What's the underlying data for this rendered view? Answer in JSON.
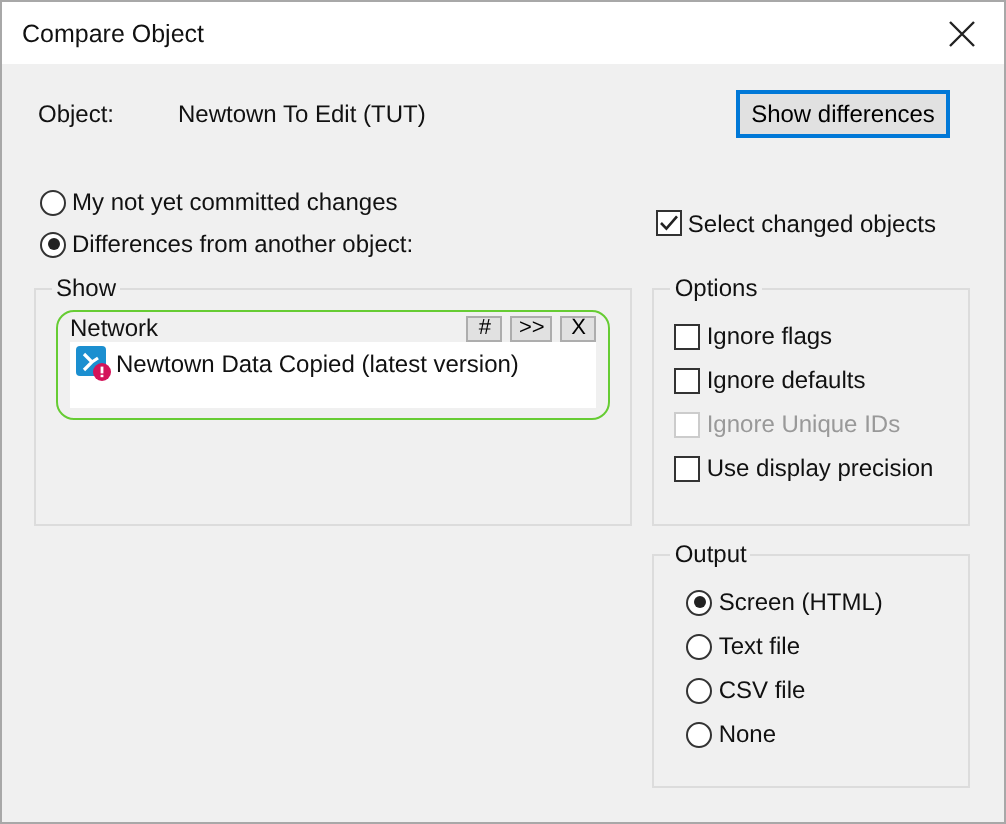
{
  "window": {
    "title": "Compare Object"
  },
  "object": {
    "label": "Object:",
    "value": "Newtown To Edit (TUT)"
  },
  "show_differences_button": "Show differences",
  "compare_with": [
    {
      "label": "My not yet committed changes",
      "selected": false
    },
    {
      "label": "Differences from another object:",
      "selected": true
    }
  ],
  "select_changed_objects": {
    "label": "Select changed objects",
    "checked": true
  },
  "show": {
    "title": "Show",
    "network": {
      "title": "Network",
      "buttons": [
        "#",
        ">>",
        "X"
      ],
      "items": [
        {
          "label": "Newtown Data Copied (latest version)"
        }
      ]
    }
  },
  "options": {
    "title": "Options",
    "items": [
      {
        "label": "Ignore flags",
        "checked": false,
        "disabled": false
      },
      {
        "label": "Ignore defaults",
        "checked": false,
        "disabled": false
      },
      {
        "label": "Ignore Unique IDs",
        "checked": false,
        "disabled": true
      },
      {
        "label": "Use display precision",
        "checked": false,
        "disabled": false
      }
    ]
  },
  "output": {
    "title": "Output",
    "items": [
      {
        "label": "Screen (HTML)",
        "selected": true
      },
      {
        "label": "Text file",
        "selected": false
      },
      {
        "label": "CSV file",
        "selected": false
      },
      {
        "label": "None",
        "selected": false
      }
    ]
  }
}
